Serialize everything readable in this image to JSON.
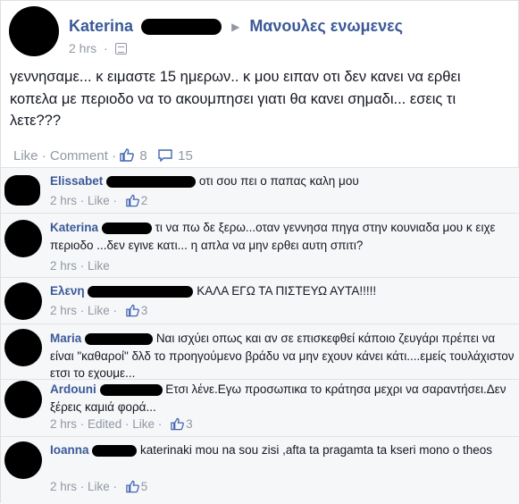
{
  "post": {
    "author_first": "Katerina",
    "group": "Μανουλες ενωμενες",
    "time": "2 hrs",
    "text": "γεννησαμε... κ ειμαστε 15 ημερων.. κ μου ειπαν οτι δεν κανει να ερθει κοπελα με περιοδο να το ακουμπησει γιατι θα κανει σημαδι... εσεις τι λετε???",
    "like_label": "Like",
    "comment_label": "Comment",
    "likes_count": "8",
    "comments_count": "15"
  },
  "comments": [
    {
      "name": "Elissabet",
      "text": "οτι σου πει ο παπας καλη μου",
      "time": "2 hrs",
      "like": "Like",
      "likes": "2",
      "edited": ""
    },
    {
      "name": "Katerina",
      "text": "τι να πω δε ξερω...οταν γεννησα πηγα στην κουνιαδα μου κ ειχε περιοδο ...δεν εγινε κατι... η απλα να μην ερθει αυτη σπιτι?",
      "time": "2 hrs",
      "like": "Like",
      "likes": "",
      "edited": ""
    },
    {
      "name": "Ελενη",
      "text": "ΚΑΛΑ ΕΓΩ ΤΑ ΠΙΣΤΕΥΩ ΑΥΤΑ!!!!!",
      "time": "2 hrs",
      "like": "Like",
      "likes": "3",
      "edited": ""
    },
    {
      "name": "Maria",
      "text": "Ναι ισχύει οπως και αν σε επισκεφθεί κάποιο ζευγάρι πρέπει να είναι \"καθαροί\" δλδ το προηγούμενο βράδυ να μην εχουν κάνει κάτι....εμείς τουλάχιστον ετσι το εχουμε...",
      "time": "",
      "like": "",
      "likes": "",
      "edited": ""
    },
    {
      "name": "Ardouni",
      "text": "Ετσι λένε.Εγω προσωπικα το κράτησα μεχρι να σαραντήσει.Δεν ξέρεις καμιά φορά...",
      "time": "2 hrs",
      "like": "Like",
      "likes": "3",
      "edited": "Edited"
    },
    {
      "name": "Ioanna",
      "text": "katerinaki mou na sou zisi ,afta ta pragamta ta kseri mono o theos",
      "time": "2 hrs",
      "like": "Like",
      "likes": "5",
      "edited": ""
    }
  ]
}
